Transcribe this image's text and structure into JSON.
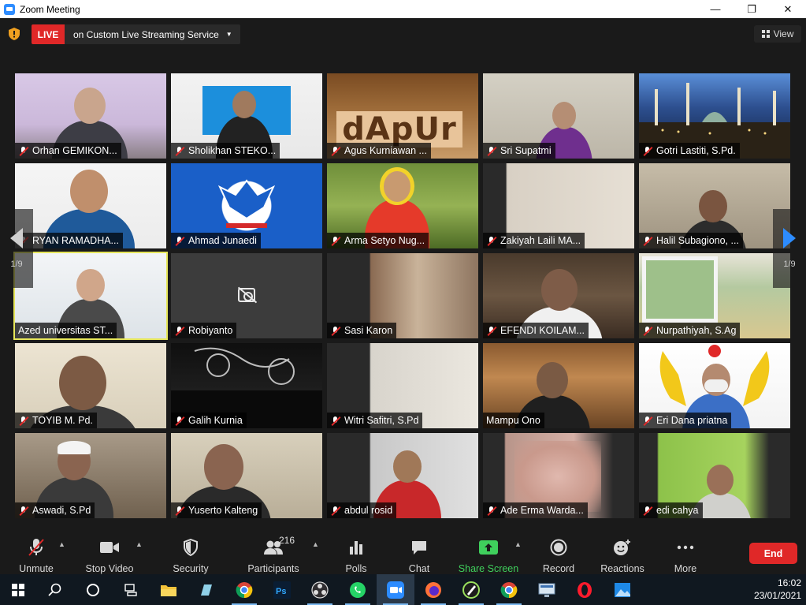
{
  "window": {
    "title": "Zoom Meeting",
    "minimize": "—",
    "maximize": "❐",
    "close": "✕"
  },
  "topbar": {
    "live_label": "LIVE",
    "live_service": "on Custom Live Streaming Service",
    "view_label": "View"
  },
  "pagination": {
    "left_page": "1/9",
    "right_page": "1/9"
  },
  "participants": [
    {
      "name": "Orhan GEMIKON...",
      "muted": true
    },
    {
      "name": "Sholikhan STEKO...",
      "muted": true
    },
    {
      "name": "Agus Kurniawan ...",
      "muted": true
    },
    {
      "name": "Sri Supatmi",
      "muted": true
    },
    {
      "name": "Gotri Lastiti, S.Pd.",
      "muted": true
    },
    {
      "name": "RYAN RAMADHA...",
      "muted": true
    },
    {
      "name": "Ahmad Junaedi",
      "muted": true
    },
    {
      "name": "Arma Setyo Nug...",
      "muted": true
    },
    {
      "name": "Zakiyah Laili MA...",
      "muted": true
    },
    {
      "name": "Halil Subagiono, ...",
      "muted": true
    },
    {
      "name": "Azed universitas ST...",
      "muted": false
    },
    {
      "name": "Robiyanto",
      "muted": true
    },
    {
      "name": "Sasi Karon",
      "muted": true
    },
    {
      "name": "EFENDI KOILAM...",
      "muted": true
    },
    {
      "name": "Nurpathiyah, S.Ag",
      "muted": true
    },
    {
      "name": "TOYIB M. Pd.",
      "muted": true
    },
    {
      "name": "Galih Kurnia",
      "muted": true
    },
    {
      "name": "Witri Safitri, S.Pd",
      "muted": true
    },
    {
      "name": "Mampu Ono",
      "muted": false
    },
    {
      "name": "Eri Dana priatna",
      "muted": true
    },
    {
      "name": "Aswadi, S.Pd",
      "muted": true
    },
    {
      "name": "Yuserto Kalteng",
      "muted": true
    },
    {
      "name": "abdul rosid",
      "muted": true
    },
    {
      "name": "Ade Erma Warda...",
      "muted": true
    },
    {
      "name": "edi cahya",
      "muted": true
    }
  ],
  "tile_text": {
    "dapur_sign": "dApUr"
  },
  "toolbar": {
    "unmute": "Unmute",
    "stop_video": "Stop Video",
    "security": "Security",
    "participants": "Participants",
    "participant_count": "216",
    "polls": "Polls",
    "chat": "Chat",
    "share_screen": "Share Screen",
    "record": "Record",
    "reactions": "Reactions",
    "more": "More",
    "end": "End"
  },
  "taskbar": {
    "time": "16:02",
    "date": "23/01/2021",
    "apps": [
      "start-icon",
      "search-icon",
      "cortana-icon",
      "task-view-icon",
      "file-explorer-icon",
      "notes-icon",
      "chrome-icon",
      "photoshop-icon",
      "obs-icon",
      "whatsapp-icon",
      "zoom-icon",
      "firefox-icon",
      "pen-tool-icon",
      "chrome-alt-icon",
      "remote-desktop-icon",
      "opera-icon",
      "photos-icon"
    ]
  },
  "colors": {
    "zoom_blue": "#2D8CFF",
    "live_red": "#E02828",
    "share_green": "#3FCF5C",
    "active_speaker": "#E6E65A"
  }
}
